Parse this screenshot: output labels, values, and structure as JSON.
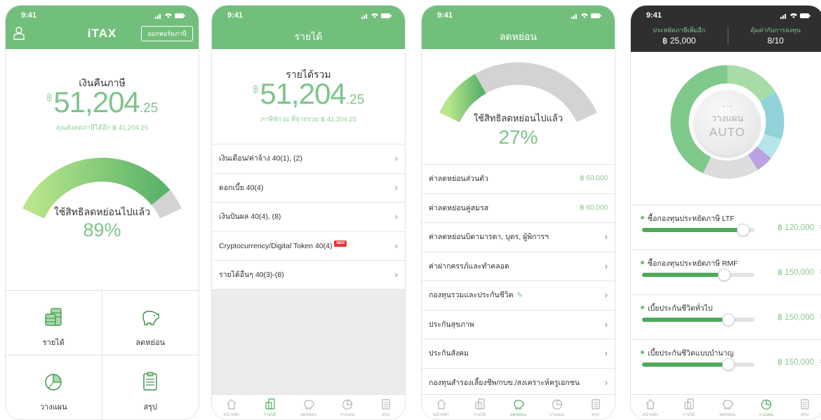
{
  "status": {
    "time": "9:41"
  },
  "colors": {
    "primary_green": "#72bf7c",
    "light_green": "#8ac98f",
    "dark_header": "#2f2f31",
    "gauge_gray": "#d3d3d3",
    "new_badge": "#e8333a"
  },
  "tabs": [
    {
      "label": "หน้าหลัก",
      "icon": "home-icon"
    },
    {
      "label": "รายได้",
      "icon": "coins-icon"
    },
    {
      "label": "ลดหย่อน",
      "icon": "piggy-bank-icon"
    },
    {
      "label": "วางแผน",
      "icon": "pie-chart-icon"
    },
    {
      "label": "สรุป",
      "icon": "clipboard-icon"
    }
  ],
  "screen1": {
    "app_name": "iTAX",
    "form_button": "ออกฟอร์มภาษี",
    "refund_label": "เงินคืนภาษี",
    "currency": "฿",
    "amount_int": "51,204",
    "amount_dec": ".25",
    "note": "คุณยังลดภาษีได้อีก ฿ 41,204.25",
    "gauge_label": "ใช้สิทธิลดหย่อนไปแล้ว",
    "gauge_value": "89%",
    "gauge_fraction": 0.89,
    "menu": [
      {
        "label": "รายได้",
        "icon": "coins-icon"
      },
      {
        "label": "ลดหย่อน",
        "icon": "piggy-bank-icon"
      },
      {
        "label": "วางแผน",
        "icon": "pie-chart-icon"
      },
      {
        "label": "สรุป",
        "icon": "clipboard-icon"
      }
    ]
  },
  "screen2": {
    "title": "รายได้",
    "total_label": "รายได้รวม",
    "currency": "฿",
    "amount_int": "51,204",
    "amount_dec": ".25",
    "withheld": "ภาษีหัก ณ ที่จ่ายรวม  ฿ 41,204.25",
    "items": [
      {
        "label": "เงินเดือน/ค่าจ้าง 40(1), (2)"
      },
      {
        "label": "ดอกเบี้ย 40(4)"
      },
      {
        "label": "เงินปันผล 40(4), (8)"
      },
      {
        "label": "Cryptocurrency/Digital Token 40(4)",
        "badge": "NEW"
      },
      {
        "label": "รายได้อื่นๆ 40(3)-(8)"
      }
    ],
    "active_tab": 1
  },
  "screen3": {
    "title": "ลดหย่อน",
    "gauge_label": "ใช้สิทธิลดหย่อนไปแล้ว",
    "gauge_value": "27%",
    "gauge_fraction": 0.27,
    "items": [
      {
        "label": "ค่าลดหย่อนส่วนตัว",
        "amount": "฿ 60,000"
      },
      {
        "label": "ค่าลดหย่อนคู่สมรส",
        "amount": "฿ 60,000"
      },
      {
        "label": "ค่าลดหย่อนบิดามารดา, บุตร, ผู้พิการฯ"
      },
      {
        "label": "ค่าฝากครรภ์และทำคลอด"
      },
      {
        "label": "กองทุนรวมและประกันชีวิต",
        "edit": true
      },
      {
        "label": "ประกันสุขภาพ"
      },
      {
        "label": "ประกันสังคม"
      },
      {
        "label": "กองทุนสำรองเลี้ยงชีพ/กบข./สงเคราะห์ครูเอกชน"
      }
    ],
    "active_tab": 2
  },
  "screen4": {
    "savings_label": "ประหยัดภาษีเพิ่มอีก",
    "savings_value": "฿ 25,000",
    "score_label": "คุ้มค่ากับการลงทุน",
    "score_value": "8/10",
    "plan_label": "วางแผน",
    "auto_label": "AUTO",
    "segments": [
      {
        "color": "#a7dca9",
        "fraction": 0.16
      },
      {
        "color": "#92d3da",
        "fraction": 0.14
      },
      {
        "color": "#b7e4ea",
        "fraction": 0.06
      },
      {
        "color": "#b9a3e3",
        "fraction": 0.05
      },
      {
        "color": "#dcdcdc",
        "fraction": 0.16
      },
      {
        "color": "#7fc98a",
        "fraction": 0.43
      }
    ],
    "sliders": [
      {
        "label": "ซื้อกองทุนประหยัดภาษี LTF",
        "value": "฿ 120,000",
        "fraction": 0.9
      },
      {
        "label": "ซื้อกองทุนประหยัดภาษี RMF",
        "value": "฿ 150,000",
        "fraction": 0.73
      },
      {
        "label": "เบี้ยประกันชีวิตทั่วไป",
        "value": "฿ 150,000",
        "fraction": 0.77
      },
      {
        "label": "เบี้ยประกันชีวิตแบบบำนาญ",
        "value": "฿ 150,000",
        "fraction": 0.77
      }
    ],
    "active_tab": 3
  }
}
